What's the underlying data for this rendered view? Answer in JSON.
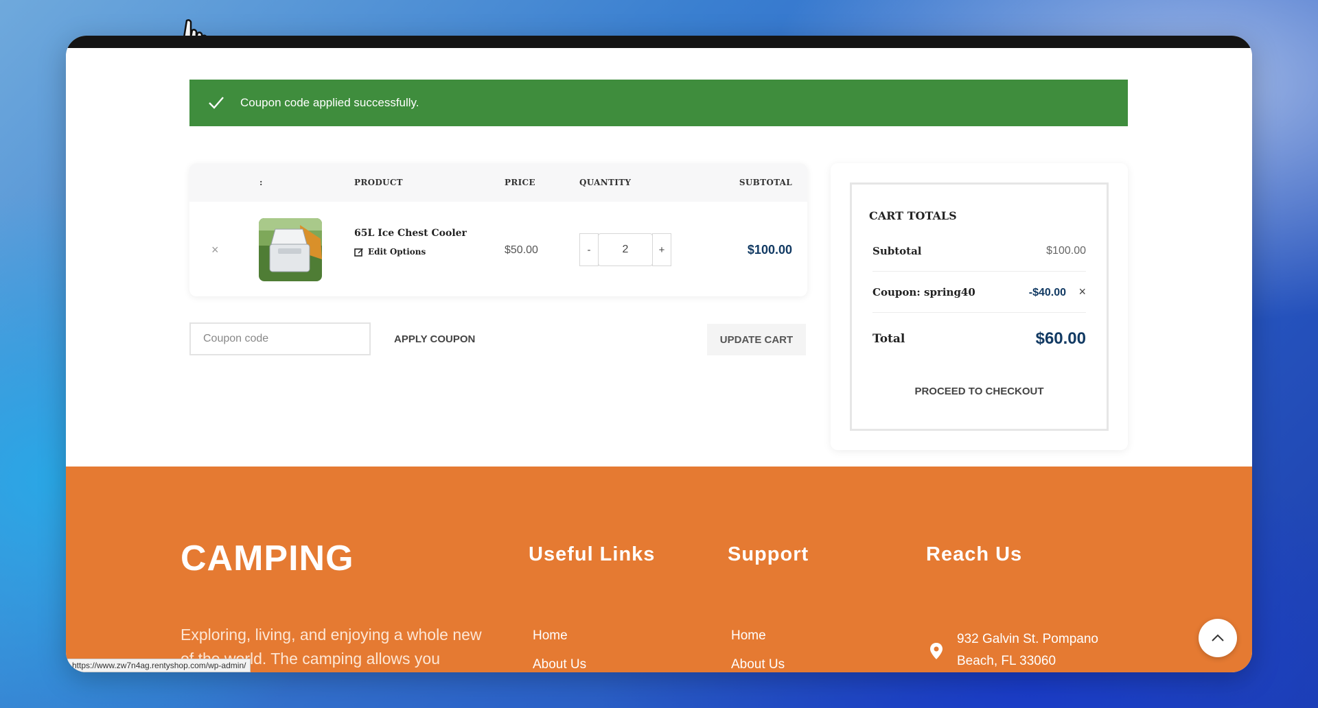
{
  "notice": {
    "text": "Coupon code applied successfully.",
    "icon": "check-icon"
  },
  "cart": {
    "headers": {
      "sort": ":",
      "product": "PRODUCT",
      "price": "PRICE",
      "quantity": "QUANTITY",
      "subtotal": "SUBTOTAL"
    },
    "items": [
      {
        "name": "65L Ice Chest Cooler",
        "edit": "Edit Options",
        "price": "$50.00",
        "quantity": "2",
        "subtotal": "$100.00"
      }
    ],
    "qty_minus": "-",
    "qty_plus": "+",
    "remove": "×"
  },
  "coupon": {
    "placeholder": "Coupon code",
    "apply_label": "APPLY COUPON",
    "update_label": "UPDATE CART"
  },
  "totals": {
    "title": "CART TOTALS",
    "subtotal_label": "Subtotal",
    "subtotal_value": "$100.00",
    "coupon_label": "Coupon: spring40",
    "coupon_value": "-$40.00",
    "coupon_remove": "×",
    "total_label": "Total",
    "total_value": "$60.00",
    "checkout_label": "PROCEED TO CHECKOUT"
  },
  "footer": {
    "brand": "CAMPING",
    "about": "Exploring, living, and enjoying a whole new of the world. The camping allows you",
    "useful_links": {
      "title": "Useful Links",
      "items": [
        "Home",
        "About Us"
      ]
    },
    "support": {
      "title": "Support",
      "items": [
        "Home",
        "About Us"
      ]
    },
    "reach_us": {
      "title": "Reach Us",
      "address_line1": "932 Galvin St. Pompano",
      "address_line2": "Beach, FL 33060"
    }
  },
  "status_bar": {
    "url": "https://www.zw7n4ag.rentyshop.com/wp-admin/"
  },
  "colors": {
    "notice_green": "#3f8d3d",
    "footer_orange": "#e57a32",
    "price_navy": "#123a63"
  }
}
